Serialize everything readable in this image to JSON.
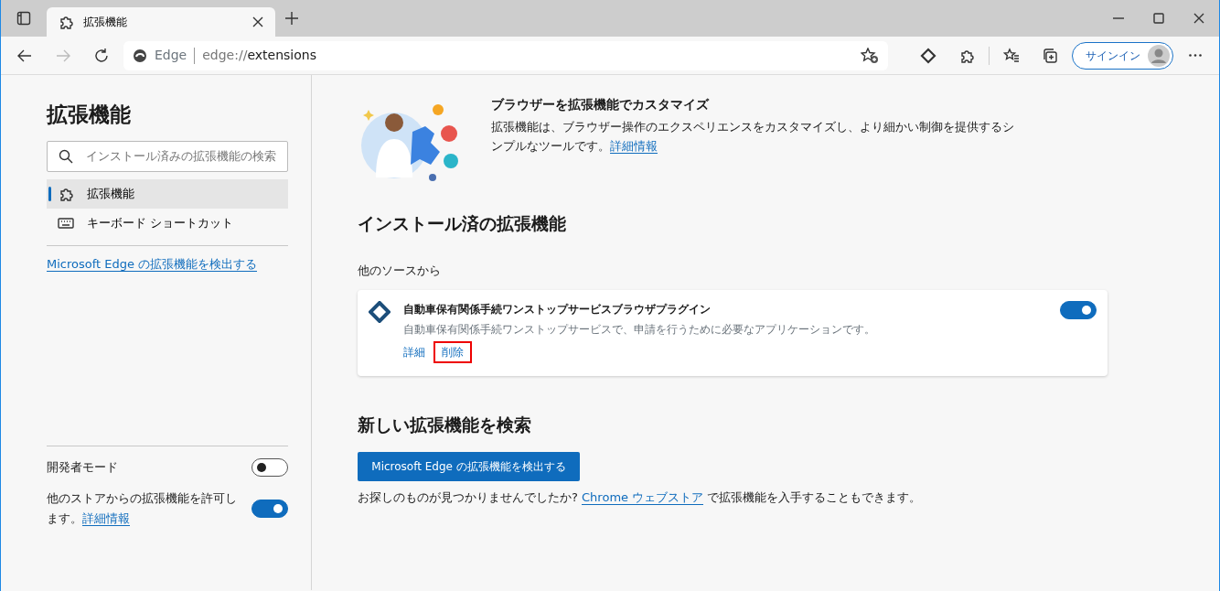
{
  "tabs": [
    {
      "title": "拡張機能",
      "selected": true
    }
  ],
  "address": {
    "site": "Edge",
    "url_scheme": "edge://",
    "url_path": "extensions"
  },
  "toolbar": {
    "signin": "サインイン"
  },
  "sidebar": {
    "title": "拡張機能",
    "search_placeholder": "インストール済みの拡張機能の検索",
    "items": [
      {
        "label": "拡張機能",
        "kind": "puzzle",
        "selected": true
      },
      {
        "label": "キーボード ショートカット",
        "kind": "keyboard",
        "selected": false
      }
    ],
    "discover_link": "Microsoft Edge の拡張機能を検出する",
    "settings": [
      {
        "label": "開発者モード",
        "on": false
      },
      {
        "label": "他のストアからの拡張機能を許可します。",
        "link": "詳細情報",
        "on": true
      }
    ]
  },
  "hero": {
    "title": "ブラウザーを拡張機能でカスタマイズ",
    "text": "拡張機能は、ブラウザー操作のエクスペリエンスをカスタマイズし、より細かい制御を提供するシンプルなツールです。",
    "link": "詳細情報"
  },
  "installed": {
    "heading": "インストール済の拡張機能",
    "source": "他のソースから",
    "extensions": [
      {
        "name": "自動車保有関係手続ワンストップサービスブラウザプラグイン",
        "description": "自動車保有関係手続ワンストップサービスで、申請を行うために必要なアプリケーションです。",
        "on": true,
        "actions": [
          {
            "label": "詳細",
            "highlighted": false
          },
          {
            "label": "削除",
            "highlighted": true
          }
        ]
      }
    ]
  },
  "find": {
    "heading": "新しい拡張機能を検索",
    "button": "Microsoft Edge の拡張機能を検出する",
    "text_before": "お探しのものが見つかりませんでしたか?",
    "link": "Chrome ウェブストア",
    "text_after": "で拡張機能を入手することもできます。"
  }
}
